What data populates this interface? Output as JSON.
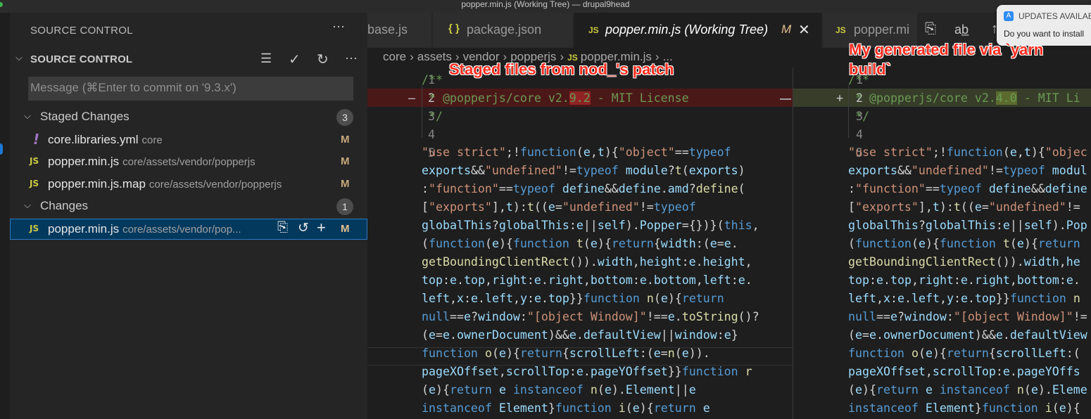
{
  "window": {
    "title": "popper.min.js (Working Tree) — drupal9head"
  },
  "sidebar": {
    "header": "SOURCE CONTROL",
    "section_title": "SOURCE CONTROL",
    "message_placeholder": "Message (⌘Enter to commit on '9.3.x')",
    "staged": {
      "label": "Staged Changes",
      "count": "3",
      "files": [
        {
          "icon": "!",
          "name": "core.libraries.yml",
          "path": "core",
          "status": "M"
        },
        {
          "icon": "JS",
          "name": "popper.min.js",
          "path": "core/assets/vendor/popperjs",
          "status": "M"
        },
        {
          "icon": "JS",
          "name": "popper.min.js.map",
          "path": "core/assets/vendor/popperjs",
          "status": "M"
        }
      ]
    },
    "changes": {
      "label": "Changes",
      "count": "1",
      "files": [
        {
          "icon": "JS",
          "name": "popper.min.js",
          "path": "core/assets/vendor/pop...",
          "status": "M"
        }
      ]
    }
  },
  "tabs": [
    {
      "icon": "",
      "label": "base.js"
    },
    {
      "icon": "{ }",
      "label": "package.json"
    },
    {
      "icon": "JS",
      "label": "popper.min.js (Working Tree)",
      "modified": "M"
    },
    {
      "icon": "JS",
      "label": "popper.mi"
    }
  ],
  "notification": {
    "title": "UPDATES AVAILABLE",
    "body": "Do you want to install"
  },
  "breadcrumb": [
    "core",
    "assets",
    "vendor",
    "popperjs",
    "popper.min.js",
    "..."
  ],
  "editor": {
    "left_lines": [
      "1",
      "2",
      "3",
      "4",
      "5"
    ],
    "right_lines": [
      "1",
      "2",
      "3",
      "4",
      "5"
    ],
    "left_header": {
      "l1": "/**",
      "l2_pre": " * @popperjs/core v2.",
      "l2_hl": "9.2",
      "l2_post": " - MIT License",
      "l3": " */"
    },
    "right_header": {
      "l1": "/**",
      "l2_pre": " * @popperjs/core v2.",
      "l2_hl": "4.0",
      "l2_post": " - MIT Li",
      "l3": " */"
    }
  },
  "annotations": {
    "left": "Staged files from nod_'s patch",
    "right_line1": "My generated file via `yarn",
    "right_line2": "build`"
  },
  "colors": {
    "removed_bg": "#4b1818",
    "added_bg": "#373d29",
    "annotation": "#ff2d1f",
    "selection": "#04395e"
  }
}
